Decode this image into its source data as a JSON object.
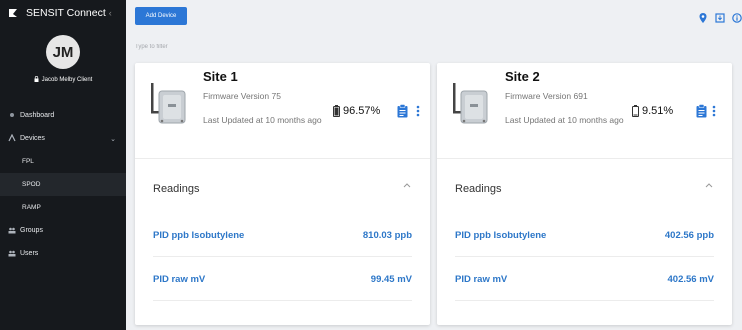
{
  "sidebar": {
    "app_title": "SENSIT Connect",
    "avatar_initials": "JM",
    "user_name": "Jacob Melby Client",
    "nav": [
      {
        "label": "Dashboard",
        "icon": "dashboard-icon"
      },
      {
        "label": "Devices",
        "icon": "devices-icon"
      },
      {
        "label": "Groups",
        "icon": "groups-icon"
      },
      {
        "label": "Users",
        "icon": "users-icon"
      }
    ],
    "devices_sub": [
      {
        "label": "FPL"
      },
      {
        "label": "SPOD"
      },
      {
        "label": "RAMP"
      }
    ]
  },
  "toolbar": {
    "add_label": "Add Device",
    "filter_placeholder": "Type to filter"
  },
  "cards": [
    {
      "title": "Site 1",
      "firmware": "Firmware Version 75",
      "updated": "Last Updated at 10 months ago",
      "battery": "96.57%",
      "readings_label": "Readings",
      "rows": [
        {
          "name": "PID ppb Isobutylene",
          "value": "810.03 ppb"
        },
        {
          "name": "PID raw mV",
          "value": "99.45 mV"
        }
      ]
    },
    {
      "title": "Site 2",
      "firmware": "Firmware Version 691",
      "updated": "Last Updated at 10 months ago",
      "battery": "9.51%",
      "readings_label": "Readings",
      "rows": [
        {
          "name": "PID ppb Isobutylene",
          "value": "402.56 ppb"
        },
        {
          "name": "PID raw mV",
          "value": "402.56 mV"
        }
      ]
    }
  ],
  "colors": {
    "sidebar_bg": "#16191d",
    "accent": "#2c77d6",
    "reading_text": "#2d77c8"
  }
}
